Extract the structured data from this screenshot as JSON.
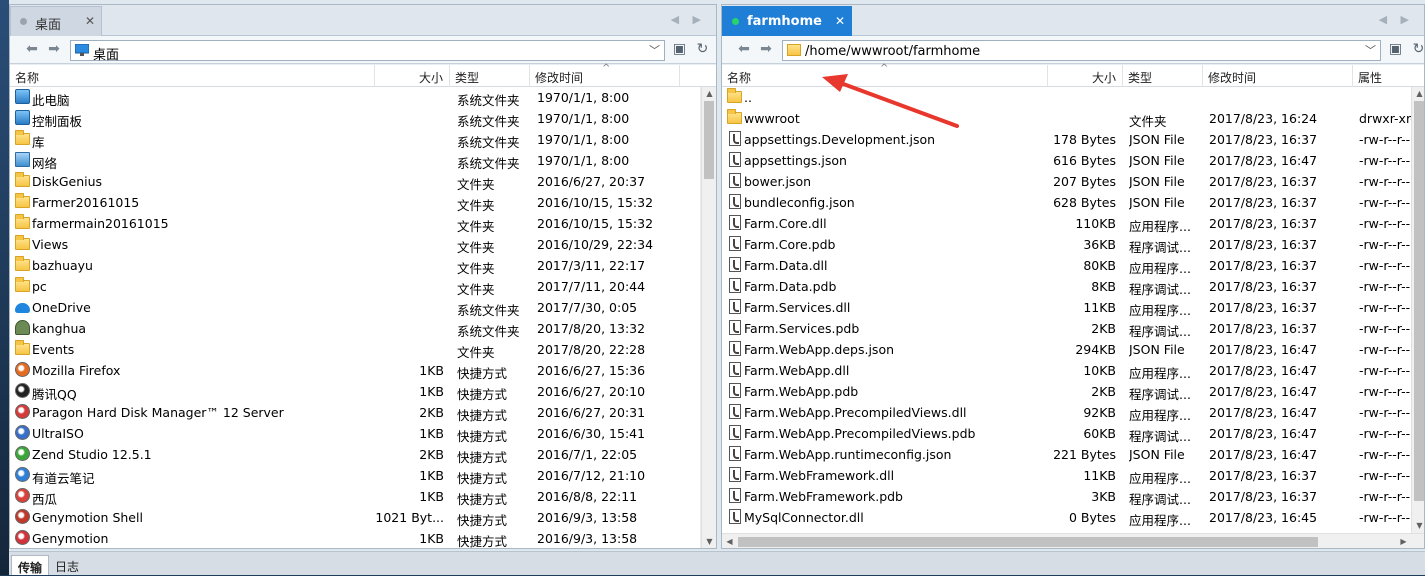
{
  "left_pane": {
    "tab": {
      "label": "桌面"
    },
    "path": "桌面",
    "columns": {
      "name": "名称",
      "size": "大小",
      "type": "类型",
      "modified": "修改时间"
    },
    "files": [
      {
        "name": "此电脑",
        "size": "",
        "type": "系统文件夹",
        "modified": "1970/1/1, 8:00",
        "icon": "computer-icon"
      },
      {
        "name": "控制面板",
        "size": "",
        "type": "系统文件夹",
        "modified": "1970/1/1, 8:00",
        "icon": "control-panel-icon"
      },
      {
        "name": "库",
        "size": "",
        "type": "系统文件夹",
        "modified": "1970/1/1, 8:00",
        "icon": "library-icon"
      },
      {
        "name": "网络",
        "size": "",
        "type": "系统文件夹",
        "modified": "1970/1/1, 8:00",
        "icon": "network-icon"
      },
      {
        "name": "DiskGenius",
        "size": "",
        "type": "文件夹",
        "modified": "2016/6/27, 20:37",
        "icon": "folder-icon"
      },
      {
        "name": "Farmer20161015",
        "size": "",
        "type": "文件夹",
        "modified": "2016/10/15, 15:32",
        "icon": "folder-icon"
      },
      {
        "name": "farmermain20161015",
        "size": "",
        "type": "文件夹",
        "modified": "2016/10/15, 15:32",
        "icon": "folder-icon"
      },
      {
        "name": "Views",
        "size": "",
        "type": "文件夹",
        "modified": "2016/10/29, 22:34",
        "icon": "folder-icon"
      },
      {
        "name": "bazhuayu",
        "size": "",
        "type": "文件夹",
        "modified": "2017/3/11, 22:17",
        "icon": "folder-icon"
      },
      {
        "name": "pc",
        "size": "",
        "type": "文件夹",
        "modified": "2017/7/11, 20:44",
        "icon": "folder-icon"
      },
      {
        "name": "OneDrive",
        "size": "",
        "type": "系统文件夹",
        "modified": "2017/7/30, 0:05",
        "icon": "cloud-icon"
      },
      {
        "name": "kanghua",
        "size": "",
        "type": "系统文件夹",
        "modified": "2017/8/20, 13:32",
        "icon": "user-icon"
      },
      {
        "name": "Events",
        "size": "",
        "type": "文件夹",
        "modified": "2017/8/20, 22:28",
        "icon": "folder-icon"
      },
      {
        "name": "Mozilla Firefox",
        "size": "1KB",
        "type": "快捷方式",
        "modified": "2016/6/27, 15:36",
        "icon": "firefox-icon"
      },
      {
        "name": "腾讯QQ",
        "size": "1KB",
        "type": "快捷方式",
        "modified": "2016/6/27, 20:10",
        "icon": "qq-icon"
      },
      {
        "name": "Paragon Hard Disk Manager™ 12 Server",
        "size": "2KB",
        "type": "快捷方式",
        "modified": "2016/6/27, 20:31",
        "icon": "paragon-icon"
      },
      {
        "name": "UltraISO",
        "size": "1KB",
        "type": "快捷方式",
        "modified": "2016/6/30, 15:41",
        "icon": "ultraiso-icon"
      },
      {
        "name": "Zend Studio 12.5.1",
        "size": "2KB",
        "type": "快捷方式",
        "modified": "2016/7/1, 22:05",
        "icon": "zend-icon"
      },
      {
        "name": "有道云笔记",
        "size": "1KB",
        "type": "快捷方式",
        "modified": "2016/7/12, 21:10",
        "icon": "youdao-icon"
      },
      {
        "name": "西瓜",
        "size": "1KB",
        "type": "快捷方式",
        "modified": "2016/8/8, 22:11",
        "icon": "xigua-icon"
      },
      {
        "name": "Genymotion Shell",
        "size": "1021 Byt...",
        "type": "快捷方式",
        "modified": "2016/9/3, 13:58",
        "icon": "genymotion-shell-icon"
      },
      {
        "name": "Genymotion",
        "size": "1KB",
        "type": "快捷方式",
        "modified": "2016/9/3, 13:58",
        "icon": "genymotion-icon"
      }
    ]
  },
  "right_pane": {
    "tab": {
      "label": "farmhome"
    },
    "path": "/home/wwwroot/farmhome",
    "columns": {
      "name": "名称",
      "size": "大小",
      "type": "类型",
      "modified": "修改时间",
      "attr": "属性"
    },
    "files": [
      {
        "name": "..",
        "size": "",
        "type": "",
        "modified": "",
        "attr": "",
        "icon": "folder-icon"
      },
      {
        "name": "wwwroot",
        "size": "",
        "type": "文件夹",
        "modified": "2017/8/23, 16:24",
        "attr": "drwxr-xr-x",
        "icon": "folder-icon"
      },
      {
        "name": "appsettings.Development.json",
        "size": "178 Bytes",
        "type": "JSON File",
        "modified": "2017/8/23, 16:37",
        "attr": "-rw-r--r--",
        "icon": "file-icon"
      },
      {
        "name": "appsettings.json",
        "size": "616 Bytes",
        "type": "JSON File",
        "modified": "2017/8/23, 16:47",
        "attr": "-rw-r--r--",
        "icon": "file-icon"
      },
      {
        "name": "bower.json",
        "size": "207 Bytes",
        "type": "JSON File",
        "modified": "2017/8/23, 16:37",
        "attr": "-rw-r--r--",
        "icon": "file-icon"
      },
      {
        "name": "bundleconfig.json",
        "size": "628 Bytes",
        "type": "JSON File",
        "modified": "2017/8/23, 16:37",
        "attr": "-rw-r--r--",
        "icon": "file-icon"
      },
      {
        "name": "Farm.Core.dll",
        "size": "110KB",
        "type": "应用程序...",
        "modified": "2017/8/23, 16:37",
        "attr": "-rw-r--r--",
        "icon": "file-icon"
      },
      {
        "name": "Farm.Core.pdb",
        "size": "36KB",
        "type": "程序调试...",
        "modified": "2017/8/23, 16:37",
        "attr": "-rw-r--r--",
        "icon": "file-icon"
      },
      {
        "name": "Farm.Data.dll",
        "size": "80KB",
        "type": "应用程序...",
        "modified": "2017/8/23, 16:37",
        "attr": "-rw-r--r--",
        "icon": "file-icon"
      },
      {
        "name": "Farm.Data.pdb",
        "size": "8KB",
        "type": "程序调试...",
        "modified": "2017/8/23, 16:37",
        "attr": "-rw-r--r--",
        "icon": "file-icon"
      },
      {
        "name": "Farm.Services.dll",
        "size": "11KB",
        "type": "应用程序...",
        "modified": "2017/8/23, 16:37",
        "attr": "-rw-r--r--",
        "icon": "file-icon"
      },
      {
        "name": "Farm.Services.pdb",
        "size": "2KB",
        "type": "程序调试...",
        "modified": "2017/8/23, 16:37",
        "attr": "-rw-r--r--",
        "icon": "file-icon"
      },
      {
        "name": "Farm.WebApp.deps.json",
        "size": "294KB",
        "type": "JSON File",
        "modified": "2017/8/23, 16:47",
        "attr": "-rw-r--r--",
        "icon": "file-icon"
      },
      {
        "name": "Farm.WebApp.dll",
        "size": "10KB",
        "type": "应用程序...",
        "modified": "2017/8/23, 16:47",
        "attr": "-rw-r--r--",
        "icon": "file-icon"
      },
      {
        "name": "Farm.WebApp.pdb",
        "size": "2KB",
        "type": "程序调试...",
        "modified": "2017/8/23, 16:47",
        "attr": "-rw-r--r--",
        "icon": "file-icon"
      },
      {
        "name": "Farm.WebApp.PrecompiledViews.dll",
        "size": "92KB",
        "type": "应用程序...",
        "modified": "2017/8/23, 16:47",
        "attr": "-rw-r--r--",
        "icon": "file-icon"
      },
      {
        "name": "Farm.WebApp.PrecompiledViews.pdb",
        "size": "60KB",
        "type": "程序调试...",
        "modified": "2017/8/23, 16:47",
        "attr": "-rw-r--r--",
        "icon": "file-icon"
      },
      {
        "name": "Farm.WebApp.runtimeconfig.json",
        "size": "221 Bytes",
        "type": "JSON File",
        "modified": "2017/8/23, 16:47",
        "attr": "-rw-r--r--",
        "icon": "file-icon"
      },
      {
        "name": "Farm.WebFramework.dll",
        "size": "11KB",
        "type": "应用程序...",
        "modified": "2017/8/23, 16:37",
        "attr": "-rw-r--r--",
        "icon": "file-icon"
      },
      {
        "name": "Farm.WebFramework.pdb",
        "size": "3KB",
        "type": "程序调试...",
        "modified": "2017/8/23, 16:37",
        "attr": "-rw-r--r--",
        "icon": "file-icon"
      },
      {
        "name": "MySqlConnector.dll",
        "size": "0 Bytes",
        "type": "应用程序...",
        "modified": "2017/8/23, 16:45",
        "attr": "-rw-r--r--",
        "icon": "file-icon"
      }
    ]
  },
  "bottom_tabs": [
    {
      "label": "传输"
    },
    {
      "label": "日志"
    }
  ],
  "colors": {
    "accent": "#1f7fd6",
    "annotation_arrow": "#e8372c"
  }
}
